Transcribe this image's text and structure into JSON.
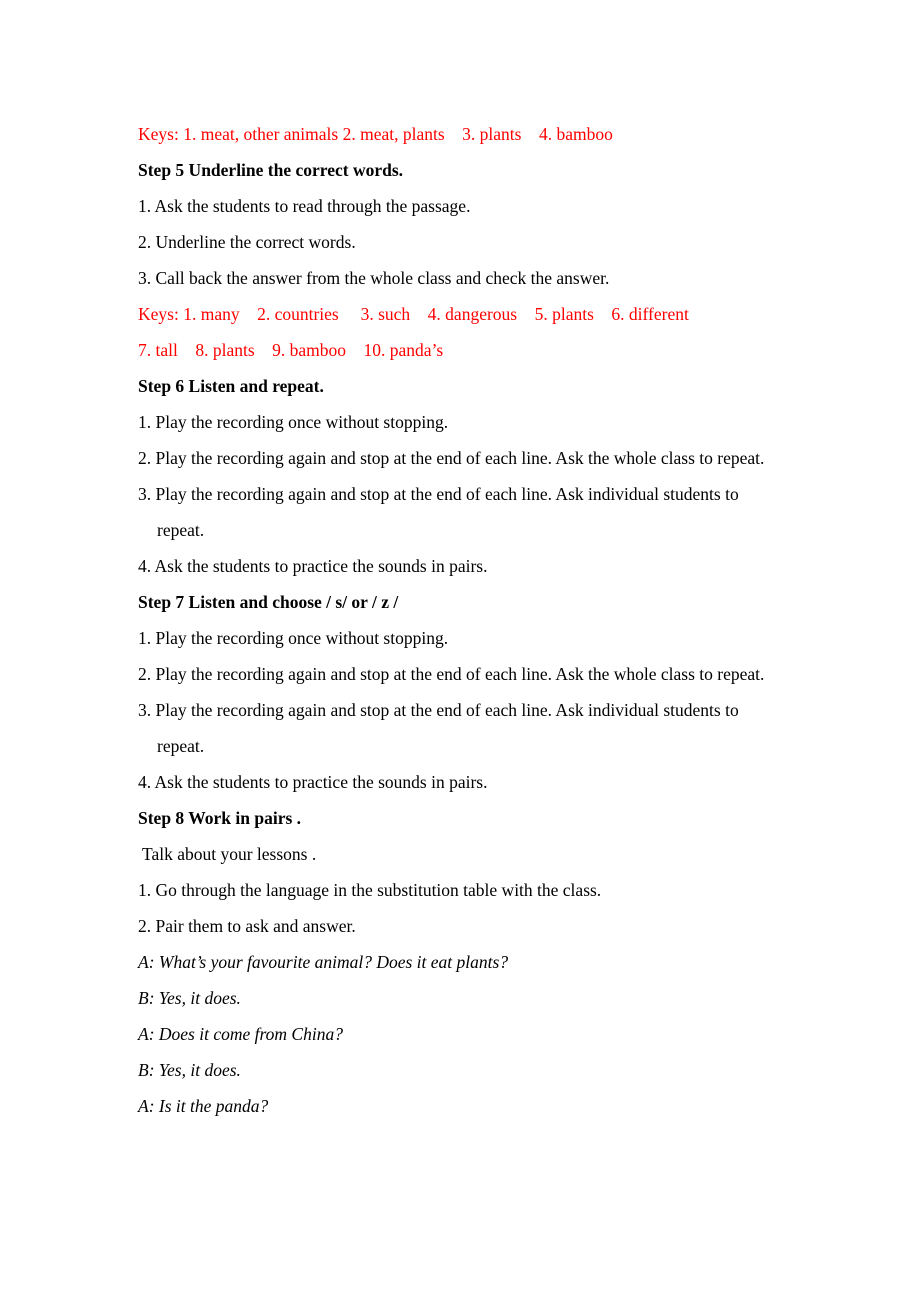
{
  "document": {
    "type": "lesson-plan-page",
    "colors": {
      "text": "#000000",
      "answer_key": "#ff0000",
      "background": "#ffffff"
    },
    "blocks": [
      {
        "id": "keys-step4",
        "style": "keys",
        "text": "Keys: 1. meat, other animals 2. meat, plants    3. plants    4. bamboo"
      },
      {
        "id": "step5-heading",
        "style": "heading",
        "text": "Step 5 Underline the correct words."
      },
      {
        "id": "step5-item1",
        "style": "item",
        "text": "1. Ask the students to read through the passage."
      },
      {
        "id": "step5-item2",
        "style": "item",
        "text": "2. Underline the correct words."
      },
      {
        "id": "step5-item3",
        "style": "item",
        "text": "3. Call back the answer from the whole class and check the answer."
      },
      {
        "id": "keys-step5-line1",
        "style": "keys",
        "text": "Keys: 1. many    2. countries     3. such    4. dangerous    5. plants    6. different"
      },
      {
        "id": "keys-step5-line2",
        "style": "keys",
        "text": "7. tall    8. plants    9. bamboo    10. panda’s"
      },
      {
        "id": "step6-heading",
        "style": "heading",
        "text": "Step 6 Listen and repeat."
      },
      {
        "id": "step6-item1",
        "style": "item",
        "text": "1. Play the recording once without stopping."
      },
      {
        "id": "step6-item2",
        "style": "item",
        "text": "2. Play the recording again and stop at the end of each line. Ask the whole class to repeat."
      },
      {
        "id": "step6-item3",
        "style": "item",
        "text": "3. Play the recording again and stop at the end of each line. Ask individual students to repeat."
      },
      {
        "id": "step6-item4",
        "style": "item",
        "text": "4. Ask the students to practice the sounds in pairs."
      },
      {
        "id": "step7-heading",
        "style": "heading",
        "text": "Step 7 Listen and choose / s/ or / z /"
      },
      {
        "id": "step7-item1",
        "style": "item",
        "text": "1. Play the recording once without stopping."
      },
      {
        "id": "step7-item2",
        "style": "item",
        "text": "2. Play the recording again and stop at the end of each line. Ask the whole class to repeat."
      },
      {
        "id": "step7-item3",
        "style": "item",
        "text": "3. Play the recording again and stop at the end of each line. Ask individual students to repeat."
      },
      {
        "id": "step7-item4",
        "style": "item",
        "text": "4. Ask the students to practice the sounds in pairs."
      },
      {
        "id": "step8-heading",
        "style": "heading",
        "text": "Step 8 Work in pairs ."
      },
      {
        "id": "step8-subtitle",
        "style": "indent",
        "text": "Talk about your lessons ."
      },
      {
        "id": "step8-item1",
        "style": "item",
        "text": "1. Go through the language in the substitution table with the class."
      },
      {
        "id": "step8-item2",
        "style": "item",
        "text": "2. Pair them to ask and answer."
      },
      {
        "id": "dialogue-1",
        "style": "dialogue",
        "text": "A: What’s your favourite animal? Does it eat plants?"
      },
      {
        "id": "dialogue-2",
        "style": "dialogue",
        "text": "B: Yes, it does."
      },
      {
        "id": "dialogue-3",
        "style": "dialogue",
        "text": "A: Does it come from China?"
      },
      {
        "id": "dialogue-4",
        "style": "dialogue",
        "text": "B: Yes, it does."
      },
      {
        "id": "dialogue-5",
        "style": "dialogue",
        "text": "A: Is it the panda?"
      }
    ]
  }
}
